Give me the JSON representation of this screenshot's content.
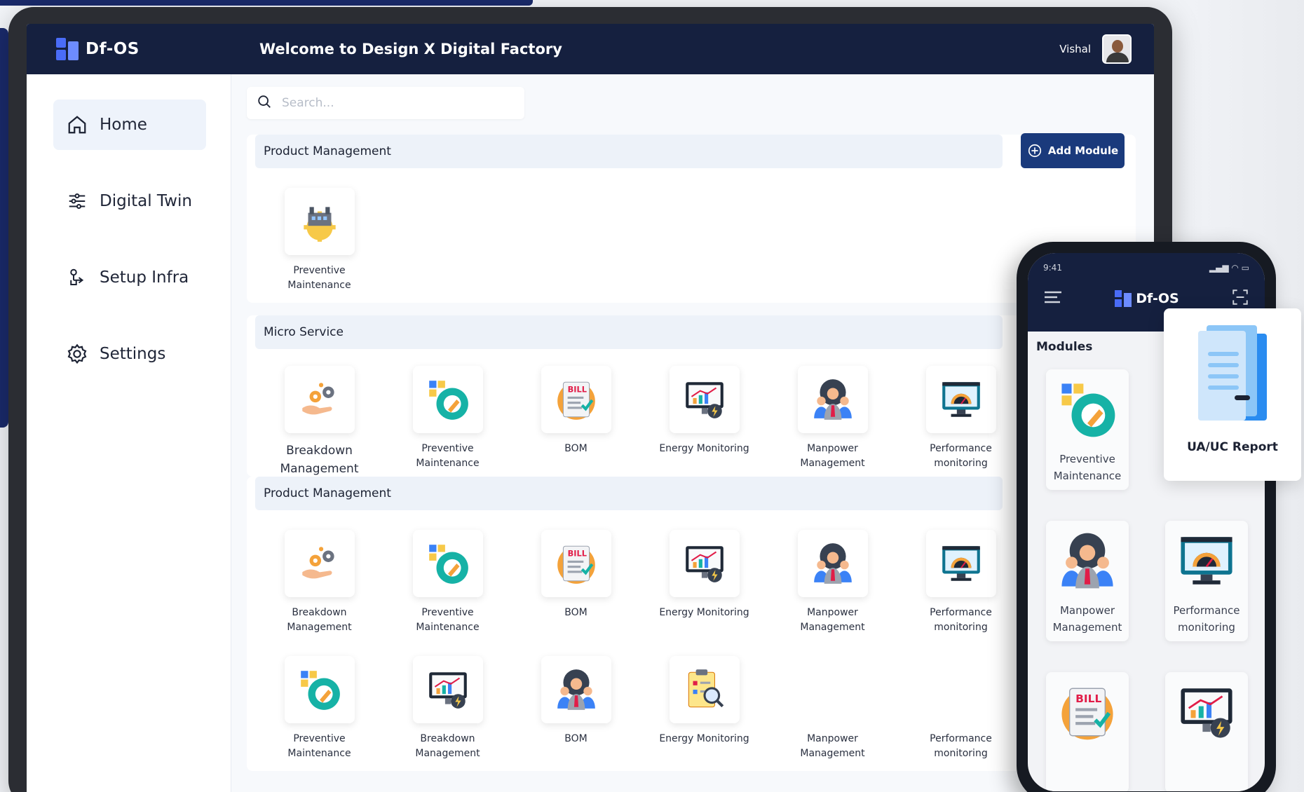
{
  "header": {
    "logo_text": "Df-OS",
    "welcome": "Welcome to Design X Digital Factory",
    "user_name": "Vishal"
  },
  "sidebar": {
    "items": [
      {
        "label": "Home",
        "icon": "home-icon",
        "active": true
      },
      {
        "label": "Digital Twin",
        "icon": "sliders-icon",
        "active": false
      },
      {
        "label": "Setup Infra",
        "icon": "network-icon",
        "active": false
      },
      {
        "label": "Settings",
        "icon": "gear-icon",
        "active": false
      }
    ]
  },
  "search": {
    "placeholder": "Search..."
  },
  "sections": {
    "product1": {
      "title": "Product Management",
      "add_button": "Add Module",
      "tiles": [
        {
          "label": "Preventive Maintenance",
          "icon": "factory-gear-icon"
        }
      ]
    },
    "micro": {
      "title": "Micro Service",
      "tiles": [
        {
          "label": "Breakdown Management",
          "icon": "hand-gears-icon"
        },
        {
          "label": "Preventive Maintenance",
          "icon": "wrench-gear-icon"
        },
        {
          "label": "BOM",
          "icon": "bill-icon"
        },
        {
          "label": "Energy Monitoring",
          "icon": "energy-monitor-icon"
        },
        {
          "label": "Manpower Management",
          "icon": "manpower-icon"
        },
        {
          "label": "Performance monitoring",
          "icon": "gauge-monitor-icon"
        }
      ]
    },
    "product2": {
      "title": "Product Management",
      "tiles_row1": [
        {
          "label": "Breakdown Management",
          "icon": "hand-gears-icon"
        },
        {
          "label": "Preventive Maintenance",
          "icon": "wrench-gear-icon"
        },
        {
          "label": "BOM",
          "icon": "bill-icon"
        },
        {
          "label": "Energy Monitoring",
          "icon": "energy-monitor-icon"
        },
        {
          "label": "Manpower Management",
          "icon": "manpower-icon"
        },
        {
          "label": "Performance monitoring",
          "icon": "gauge-monitor-icon"
        }
      ],
      "tiles_row2": [
        {
          "label": "Preventive Maintenance",
          "icon": "wrench-gear-icon"
        },
        {
          "label": "Breakdown Management",
          "icon": "energy-monitor-icon"
        },
        {
          "label": "BOM",
          "icon": "manpower-icon"
        },
        {
          "label": "Energy Monitoring",
          "icon": "clipboard-search-icon"
        },
        {
          "label": "Manpower Management",
          "icon": ""
        },
        {
          "label": "Performance monitoring",
          "icon": ""
        }
      ]
    }
  },
  "phone": {
    "time": "9:41",
    "logo_text": "Df-OS",
    "modules_title": "Modules",
    "tiles": [
      {
        "label": "Preventive Maintenance",
        "icon": "wrench-gear-icon"
      },
      {
        "label": "",
        "icon": ""
      },
      {
        "label": "Manpower Management",
        "icon": "manpower-icon"
      },
      {
        "label": "Performance monitoring",
        "icon": "gauge-monitor-icon"
      },
      {
        "label": "",
        "icon": "bill-icon"
      },
      {
        "label": "",
        "icon": "energy-monitor-icon"
      }
    ]
  },
  "popup": {
    "label": "UA/UC Report",
    "icon": "document-icon"
  },
  "colors": {
    "navy": "#15203f",
    "accent": "#1a3a7c",
    "section_bg": "#edf2f9"
  }
}
